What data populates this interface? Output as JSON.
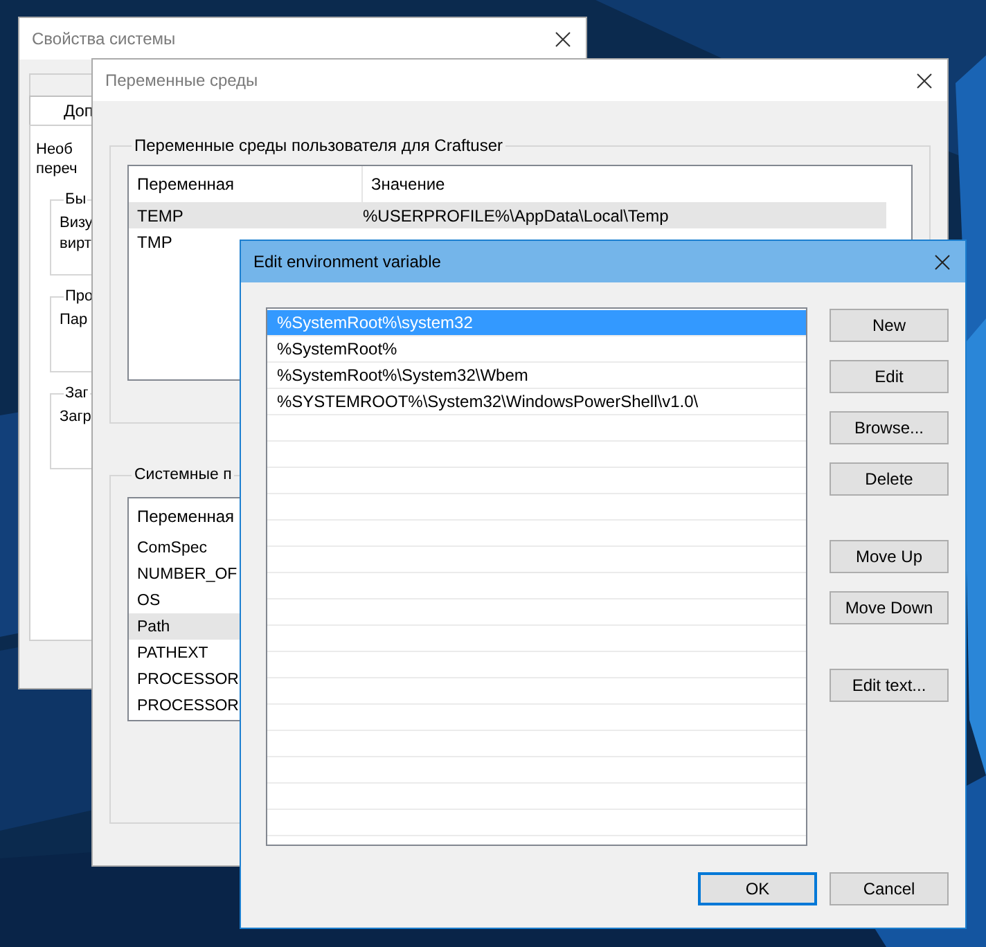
{
  "system_properties": {
    "title": "Свойства системы",
    "active": false,
    "tabs": [
      {
        "selected": false
      },
      {
        "label": "Доп",
        "selected": true
      }
    ],
    "panel_texts": [
      "Необ",
      "переч"
    ],
    "groups": [
      {
        "label": "Бы",
        "texts": [
          "Визу",
          "вирт"
        ]
      },
      {
        "label": "Про",
        "texts": [
          "Пар"
        ]
      },
      {
        "label": "Заг",
        "texts": [
          "Загр"
        ]
      }
    ]
  },
  "environment_variables": {
    "title": "Переменные среды",
    "active": false,
    "user_group": {
      "label": "Переменные среды пользователя для Craftuser",
      "columns": [
        "Переменная",
        "Значение"
      ],
      "rows": [
        {
          "name": "TEMP",
          "value": "%USERPROFILE%\\AppData\\Local\\Temp",
          "selected": true
        },
        {
          "name": "TMP",
          "selected": false
        }
      ]
    },
    "system_group": {
      "label": "Системные п",
      "columns": [
        "Переменная"
      ],
      "rows": [
        {
          "name": "ComSpec",
          "selected": false
        },
        {
          "name": "NUMBER_OF",
          "selected": false
        },
        {
          "name": "OS",
          "selected": false
        },
        {
          "name": "Path",
          "selected": true
        },
        {
          "name": "PATHEXT",
          "selected": false
        },
        {
          "name": "PROCESSOR",
          "selected": false
        },
        {
          "name": "PROCESSOR",
          "selected": false
        }
      ]
    }
  },
  "edit_dialog": {
    "title": "Edit environment variable",
    "active": true,
    "entries": [
      {
        "text": "%SystemRoot%\\system32",
        "selected": true
      },
      {
        "text": "%SystemRoot%",
        "selected": false
      },
      {
        "text": "%SystemRoot%\\System32\\Wbem",
        "selected": false
      },
      {
        "text": "%SYSTEMROOT%\\System32\\WindowsPowerShell\\v1.0\\",
        "selected": false
      }
    ],
    "button_groups": [
      [
        "New",
        "Edit",
        "Browse...",
        "Delete"
      ],
      [
        "Move Up",
        "Move Down"
      ],
      [
        "Edit text..."
      ]
    ],
    "footer_buttons": [
      {
        "label": "OK",
        "default": true
      },
      {
        "label": "Cancel",
        "default": false
      }
    ]
  }
}
